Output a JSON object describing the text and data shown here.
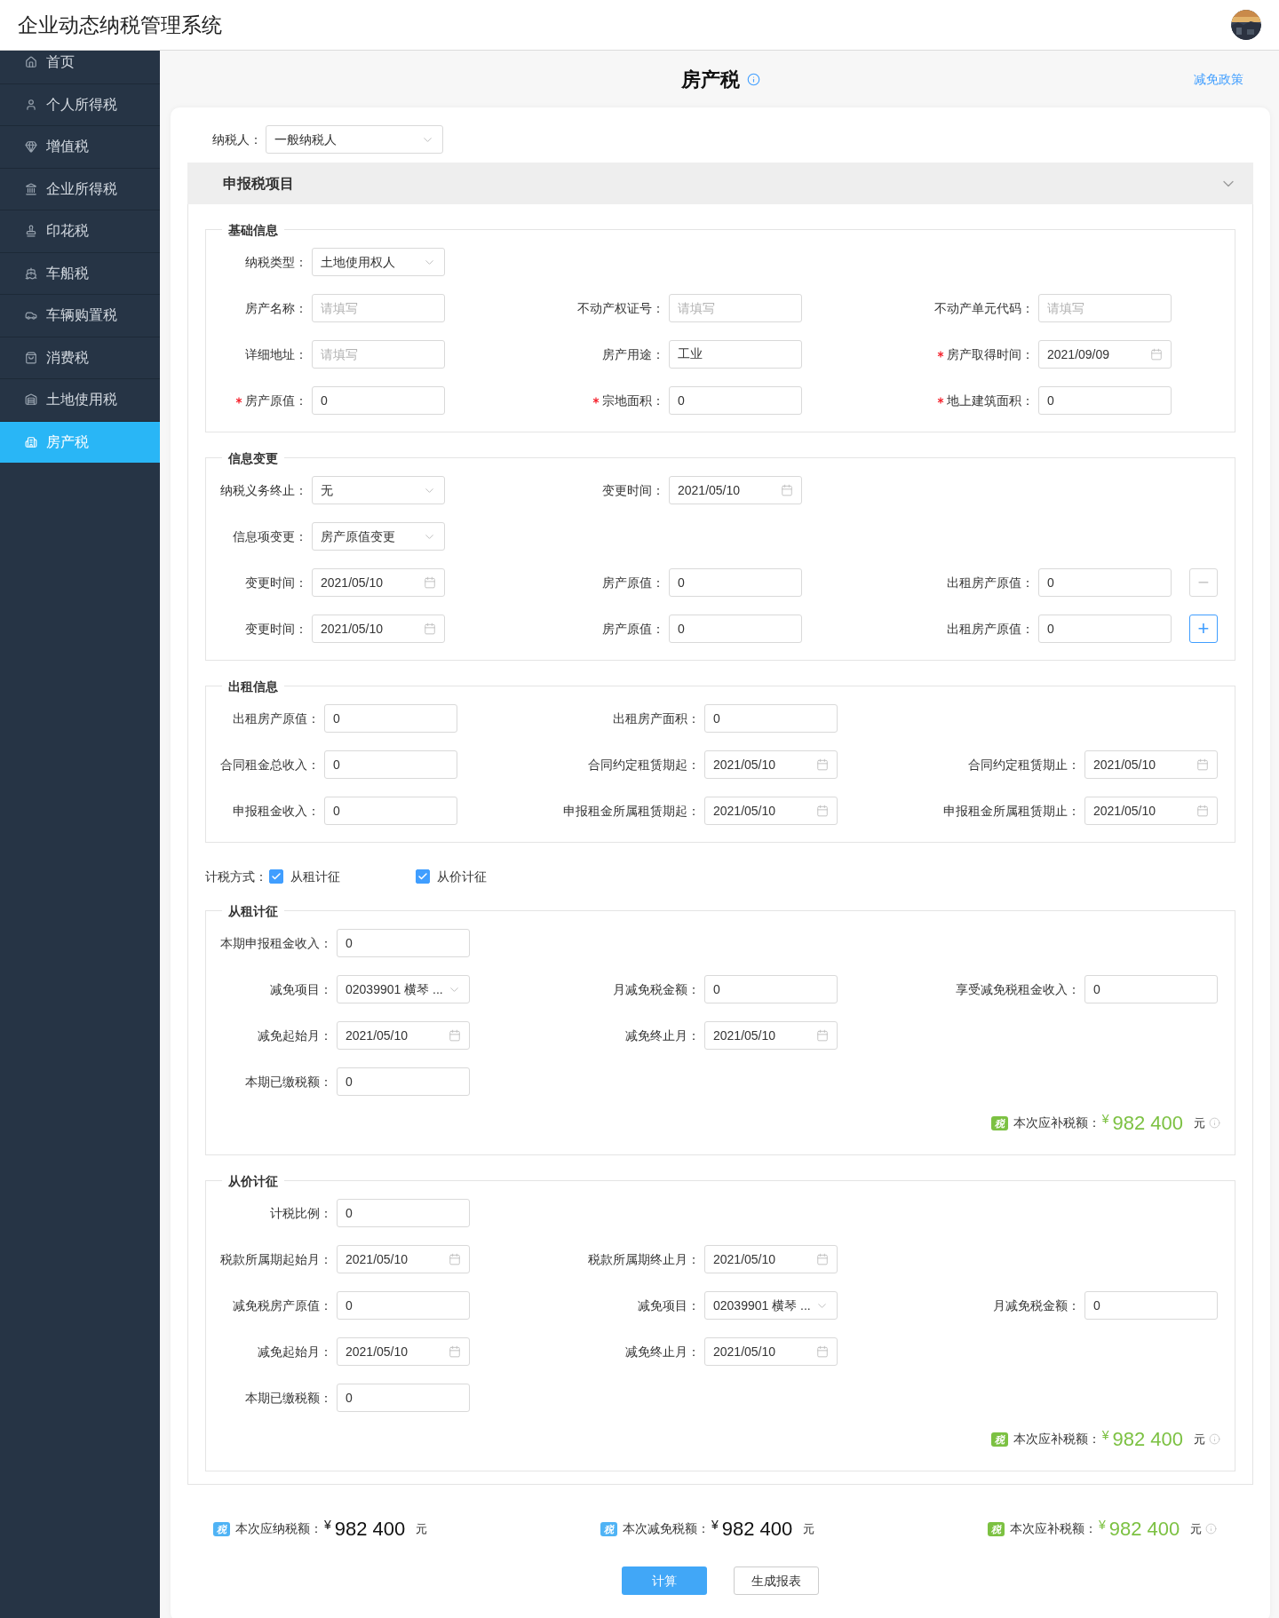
{
  "header": {
    "title": "企业动态纳税管理系统"
  },
  "sidebar": {
    "items": [
      {
        "label": "首页",
        "selected": false
      },
      {
        "label": "个人所得税",
        "selected": false
      },
      {
        "label": "增值税",
        "selected": false
      },
      {
        "label": "企业所得税",
        "selected": false
      },
      {
        "label": "印花税",
        "selected": false
      },
      {
        "label": "车船税",
        "selected": false
      },
      {
        "label": "车辆购置税",
        "selected": false
      },
      {
        "label": "消费税",
        "selected": false
      },
      {
        "label": "土地使用税",
        "selected": false
      },
      {
        "label": "房产税",
        "selected": true
      }
    ]
  },
  "page": {
    "title": "房产税",
    "link": "减免政策"
  },
  "taxpayer": {
    "label": "纳税人：",
    "value": "一般纳税人"
  },
  "panel": {
    "title": "申报税项目",
    "expanded": true,
    "blocks": [
      {
        "kind": "fieldset",
        "title": "基础信息",
        "rows": [
          {
            "fields": [
              {
                "label": "纳税类型：",
                "kind": "select",
                "value": "土地使用权人",
                "required": false
              }
            ]
          },
          {
            "fields": [
              {
                "label": "房产名称：",
                "kind": "text",
                "placeholder": "请填写",
                "required": false
              },
              {
                "label": "不动产权证号：",
                "kind": "text",
                "placeholder": "请填写",
                "required": false
              },
              {
                "label": "不动产单元代码：",
                "kind": "text",
                "placeholder": "请填写",
                "required": false
              }
            ]
          },
          {
            "fields": [
              {
                "label": "详细地址：",
                "kind": "text",
                "placeholder": "请填写",
                "required": false
              },
              {
                "label": "房产用途：",
                "kind": "text",
                "value": "工业",
                "required": false
              },
              {
                "label": "房产取得时间：",
                "kind": "date",
                "value": "2021/09/09",
                "required": true
              }
            ]
          },
          {
            "fields": [
              {
                "label": "房产原值：",
                "kind": "text",
                "value": "0",
                "required": true
              },
              {
                "label": "宗地面积：",
                "kind": "text",
                "value": "0",
                "required": true
              },
              {
                "label": "地上建筑面积：",
                "kind": "text",
                "value": "0",
                "required": true
              }
            ]
          }
        ]
      },
      {
        "kind": "fieldset",
        "title": "信息变更",
        "rows": [
          {
            "fields": [
              {
                "label": "纳税义务终止：",
                "kind": "select",
                "value": "无",
                "required": false
              },
              {
                "label": "变更时间：",
                "kind": "date",
                "value": "2021/05/10",
                "required": false
              }
            ]
          },
          {
            "fields": [
              {
                "label": "信息项变更：",
                "kind": "select",
                "value": "房产原值变更",
                "required": false
              }
            ]
          },
          {
            "action": {
              "symbol": "−",
              "disabled": true
            },
            "fields": [
              {
                "label": "变更时间：",
                "kind": "date",
                "value": "2021/05/10",
                "required": false
              },
              {
                "label": "房产原值：",
                "kind": "text",
                "value": "0",
                "required": false
              },
              {
                "label": "出租房产原值：",
                "kind": "text",
                "value": "0",
                "required": false
              }
            ]
          },
          {
            "action": {
              "symbol": "+",
              "disabled": false
            },
            "fields": [
              {
                "label": "变更时间：",
                "kind": "date",
                "value": "2021/05/10",
                "required": false
              },
              {
                "label": "房产原值：",
                "kind": "text",
                "value": "0",
                "required": false
              },
              {
                "label": "出租房产原值：",
                "kind": "text",
                "value": "0",
                "required": false
              }
            ]
          }
        ]
      },
      {
        "kind": "fieldset",
        "title": "出租信息",
        "rows": [
          {
            "fields": [
              {
                "label": "出租房产原值：",
                "kind": "text",
                "value": "0",
                "required": false
              },
              {
                "label": "出租房产面积：",
                "kind": "text",
                "value": "0",
                "required": false
              }
            ]
          },
          {
            "fields": [
              {
                "label": "合同租金总收入：",
                "kind": "text",
                "value": "0",
                "required": false
              },
              {
                "label": "合同约定租赁期起：",
                "kind": "date",
                "value": "2021/05/10",
                "required": false
              },
              {
                "label": "合同约定租赁期止：",
                "kind": "date",
                "value": "2021/05/10",
                "required": false
              }
            ]
          },
          {
            "fields": [
              {
                "label": "申报租金收入：",
                "kind": "text",
                "value": "0",
                "required": false
              },
              {
                "label": "申报租金所属租赁期起：",
                "kind": "date",
                "value": "2021/05/10",
                "required": false
              },
              {
                "label": "申报租金所属租赁期止：",
                "kind": "date",
                "value": "2021/05/10",
                "required": false
              }
            ]
          }
        ]
      },
      {
        "kind": "method",
        "label": "计税方式：",
        "options": [
          {
            "label": "从租计征",
            "checked": true
          },
          {
            "label": "从价计征",
            "checked": true
          }
        ]
      },
      {
        "kind": "fieldset",
        "title": "从租计征",
        "rows": [
          {
            "fields": [
              {
                "label": "本期申报租金收入：",
                "kind": "text",
                "value": "0",
                "required": false
              }
            ]
          },
          {
            "fields": [
              {
                "label": "减免项目：",
                "kind": "select",
                "value": "02039901 横琴 ...",
                "required": false
              },
              {
                "label": "月减免税金额：",
                "kind": "text",
                "value": "0",
                "required": false
              },
              {
                "label": "享受减免税租金收入：",
                "kind": "text",
                "value": "0",
                "required": false
              }
            ]
          },
          {
            "fields": [
              {
                "label": "减免起始月：",
                "kind": "date",
                "value": "2021/05/10",
                "required": false
              },
              {
                "label": "减免终止月：",
                "kind": "date",
                "value": "2021/05/10",
                "required": false
              }
            ]
          },
          {
            "fields": [
              {
                "label": "本期已缴税额：",
                "kind": "text",
                "value": "0",
                "required": false
              }
            ]
          }
        ],
        "total": {
          "badge": "税",
          "color": "#7cc142",
          "label": "本次应补税额：",
          "currency": "¥",
          "amount": "982 400",
          "unit": "元",
          "highlight": true
        }
      },
      {
        "kind": "fieldset",
        "title": "从价计征",
        "rows": [
          {
            "fields": [
              {
                "label": "计税比例：",
                "kind": "text",
                "value": "0",
                "required": false
              }
            ]
          },
          {
            "fields": [
              {
                "label": "税款所属期起始月：",
                "kind": "date",
                "value": "2021/05/10",
                "required": false
              },
              {
                "label": "税款所属期终止月：",
                "kind": "date",
                "value": "2021/05/10",
                "required": false
              }
            ]
          },
          {
            "fields": [
              {
                "label": "减免税房产原值：",
                "kind": "text",
                "value": "0",
                "required": false
              },
              {
                "label": "减免项目：",
                "kind": "select",
                "value": "02039901 横琴 ...",
                "required": false
              },
              {
                "label": "月减免税金额：",
                "kind": "text",
                "value": "0",
                "required": false
              }
            ]
          },
          {
            "fields": [
              {
                "label": "减免起始月：",
                "kind": "date",
                "value": "2021/05/10",
                "required": false
              },
              {
                "label": "减免终止月：",
                "kind": "date",
                "value": "2021/05/10",
                "required": false
              }
            ]
          },
          {
            "fields": [
              {
                "label": "本期已缴税额：",
                "kind": "text",
                "value": "0",
                "required": false
              }
            ]
          }
        ],
        "total": {
          "badge": "税",
          "color": "#7cc142",
          "label": "本次应补税额：",
          "currency": "¥",
          "amount": "982 400",
          "unit": "元",
          "highlight": true
        }
      }
    ]
  },
  "totals": [
    {
      "badge": "税",
      "color": "#4fb3f5",
      "label": "本次应纳税额：",
      "currency": "¥",
      "amount": "982 400",
      "unit": "元",
      "highlight": false
    },
    {
      "badge": "税",
      "color": "#4fb3f5",
      "label": "本次减免税额：",
      "currency": "¥",
      "amount": "982 400",
      "unit": "元",
      "highlight": false
    },
    {
      "badge": "税",
      "color": "#7cc142",
      "label": "本次应补税额：",
      "currency": "¥",
      "amount": "982 400",
      "unit": "元",
      "highlight": true
    }
  ],
  "buttons": [
    {
      "label": "计算",
      "kind": "primary"
    },
    {
      "label": "生成报表",
      "kind": "secondary"
    }
  ]
}
